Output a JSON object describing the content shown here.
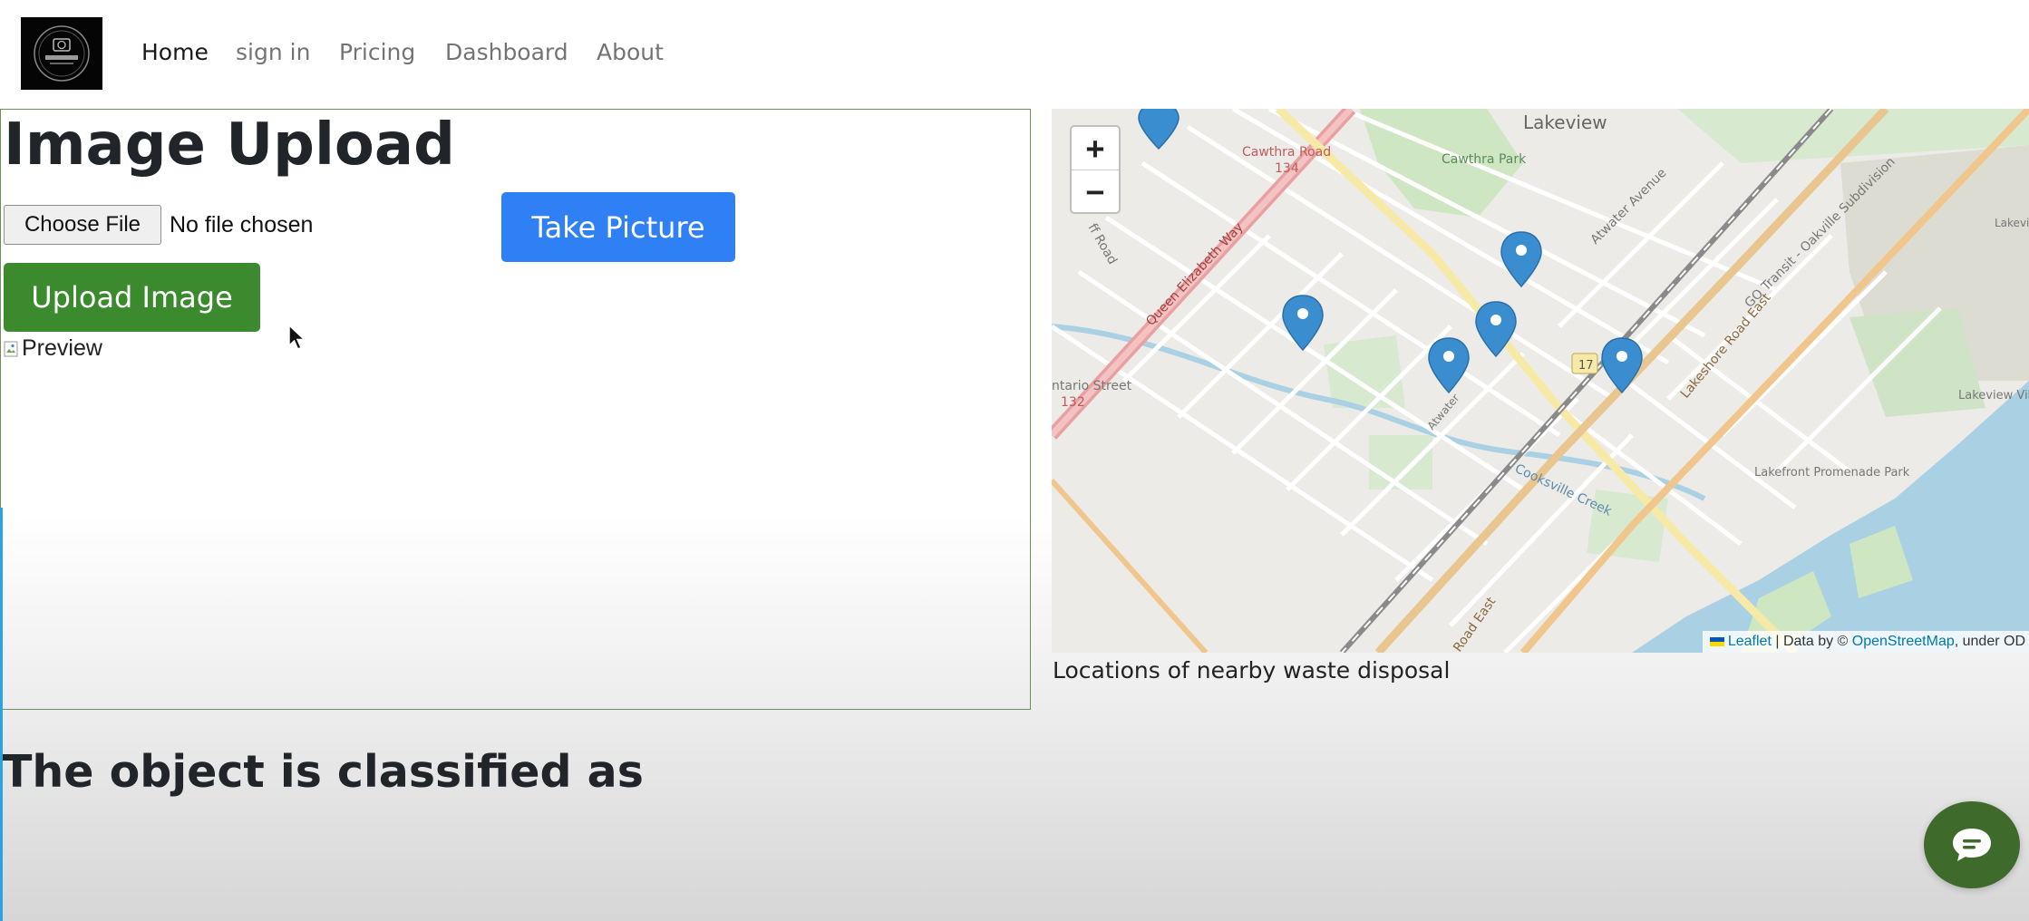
{
  "nav": {
    "logo_icon": "camera-logo-icon",
    "items": [
      {
        "label": "Home",
        "active": true
      },
      {
        "label": "sign in",
        "active": false
      },
      {
        "label": "Pricing",
        "active": false
      },
      {
        "label": "Dashboard",
        "active": false
      },
      {
        "label": "About",
        "active": false
      }
    ]
  },
  "upload": {
    "title": "Image Upload",
    "choose_file_label": "Choose File",
    "file_status": "No file chosen",
    "take_picture_label": "Take Picture",
    "upload_label": "Upload Image",
    "preview_alt": "Preview"
  },
  "map": {
    "zoom_in": "+",
    "zoom_out": "−",
    "labels": {
      "lakeview": "Lakeview",
      "cawthra_road": "Cawthra Road",
      "route_134": "134",
      "cawthra_park": "Cawthra Park",
      "atwater_avenue": "Atwater Avenue",
      "queen_elizabeth_way": "Queen Elizabeth Way",
      "off_road": "ff Road",
      "go_transit": "GO Transit - Oakville Subdivision",
      "lakeshore_road_east": "Lakeshore Road East",
      "route_17": "17",
      "ontario_street": "ntario Street",
      "route_132": "132",
      "cooksville_creek": "Cooksville Creek",
      "lakeview_village": "Lakeview Village",
      "lakefront_park": "Lakefront Promenade Park",
      "road_east": "Road East",
      "lakeview_waste": "Lakeview Wastewater Treatment Plant",
      "atwater_short": "Atwater"
    },
    "attribution": {
      "leaflet": "Leaflet",
      "separator": " | Data by © ",
      "osm": "OpenStreetMap",
      "tail": ", under OD"
    },
    "caption": "Locations of nearby waste disposal"
  },
  "result": {
    "heading": "The object is classified as"
  },
  "chat": {
    "icon": "chat-bubble-icon"
  },
  "colors": {
    "take_picture_bg": "#2f7ff5",
    "upload_bg": "#3c8a2e",
    "chat_bg": "#3e6a2b",
    "marker": "#3a8ed0"
  }
}
